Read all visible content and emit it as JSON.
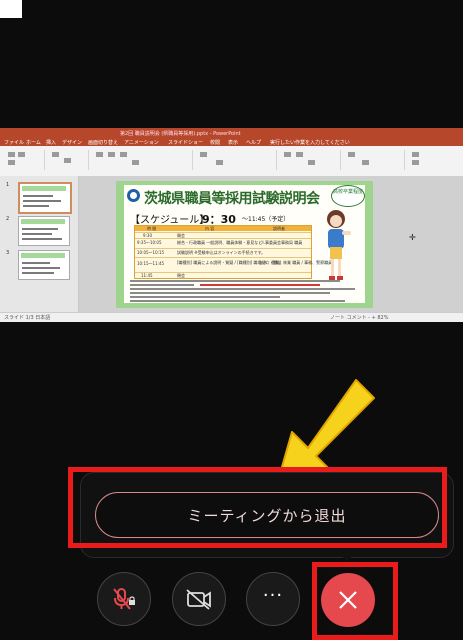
{
  "shared_screen": {
    "ppt_title": "第2回 職員説明会 (県職員等採用).pptx - PowerPoint",
    "ppt_tabs": [
      "ファイル",
      "ホーム",
      "挿入",
      "デザイン",
      "画面切り替え",
      "アニメーション",
      "スライドショー",
      "校閲",
      "表示",
      "ヘルプ",
      "実行したい作業を入力してください"
    ],
    "thumb_numbers": [
      "1",
      "2",
      "3"
    ],
    "status_left": "スライド 1/3 日本語",
    "status_right": "ノート  コメント  -  +  82%",
    "slide": {
      "title": "茨城県職員等採用試験説明会",
      "badge": "高校卒業程度",
      "schedule_label": "【スケジュール】",
      "time_range": "9：30",
      "time_end": "〜11:45（予定）",
      "table_header": [
        "時 間",
        "内 容",
        "説明者"
      ],
      "rows": [
        {
          "time": "9:30",
          "content": "開会",
          "presenter": ""
        },
        {
          "time": "9:35〜10:05",
          "content": "総合・行政職員 一般説明、職員体験・意見など",
          "presenter": "人事委員会事務局 職員"
        },
        {
          "time": "10:05〜10:15",
          "content": "試験説明 ※受験申込はオンラインの手続きです。",
          "presenter": ""
        },
        {
          "time": "10:15〜11:45",
          "content": "[職種別] 職員による説明・質疑 / [職種別] 職場紹介・懇談",
          "presenter": "土木、農業、林業 職員 / 事務、警察職員"
        },
        {
          "time": "11:45",
          "content": "閉会",
          "presenter": ""
        }
      ]
    }
  },
  "popup": {
    "leave_label": "ミーティングから退出"
  },
  "controls": [
    {
      "name": "mute",
      "icon": "mic-off-lock-icon"
    },
    {
      "name": "video",
      "icon": "video-off-icon"
    },
    {
      "name": "more",
      "icon": "more-icon",
      "label": "···"
    },
    {
      "name": "end",
      "icon": "close-icon"
    }
  ],
  "colors": {
    "end_button": "#e5484d",
    "highlight": "#ea1b1b",
    "arrow": "#f7d21c",
    "leave_border": "#d88a8a"
  }
}
